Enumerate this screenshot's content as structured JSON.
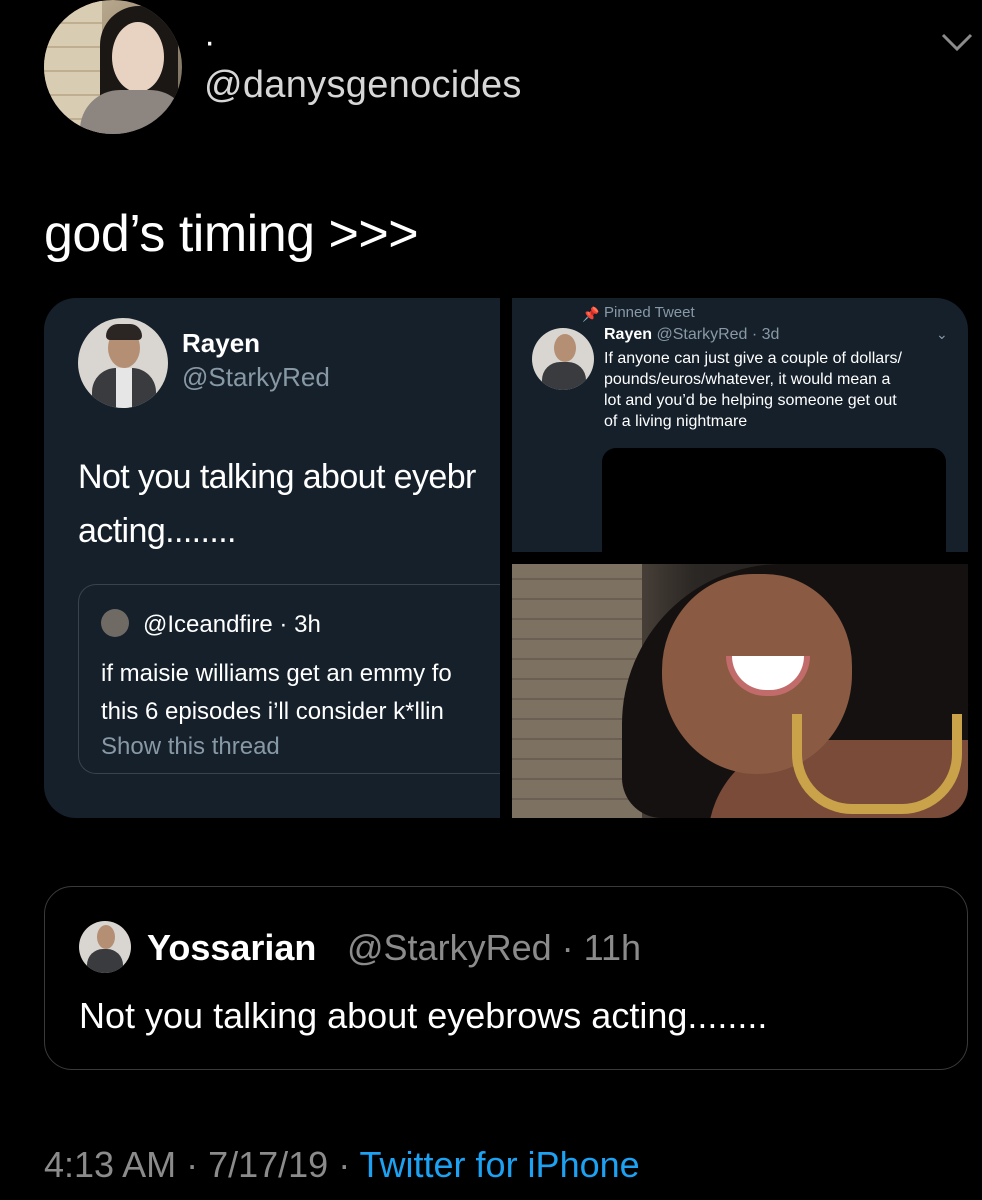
{
  "author": {
    "display_name": "·",
    "handle": "@danysgenocides"
  },
  "tweet": {
    "text": "god’s timing >>>"
  },
  "collage": {
    "left": {
      "name": "Rayen",
      "handle": "@StarkyRed",
      "text": "Not you talking about eyebr\nacting........",
      "quote": {
        "handle_time": "@Iceandfire · 3h",
        "text": "if maisie williams get an emmy fo\nthis 6 episodes i’ll consider k*llin",
        "show_thread": "Show this thread"
      }
    },
    "right_top": {
      "pinned_label": "Pinned Tweet",
      "name": "Rayen",
      "handle_time": "@StarkyRed · 3d",
      "text": "If anyone can just give a couple of dollars/\npounds/euros/whatever, it would mean a\nlot and you’d be helping someone get out\nof a living nightmare"
    }
  },
  "quoted_tweet": {
    "name": "Yossarian",
    "handle_time": "@StarkyRed · 11h",
    "text": "Not you talking about eyebrows acting........"
  },
  "footer": {
    "timestamp": "4:13 AM · 7/17/19 · ",
    "source": "Twitter for iPhone"
  },
  "colors": {
    "background": "#000000",
    "card": "#15202b",
    "muted": "#8899a6",
    "link": "#1da1f2"
  }
}
